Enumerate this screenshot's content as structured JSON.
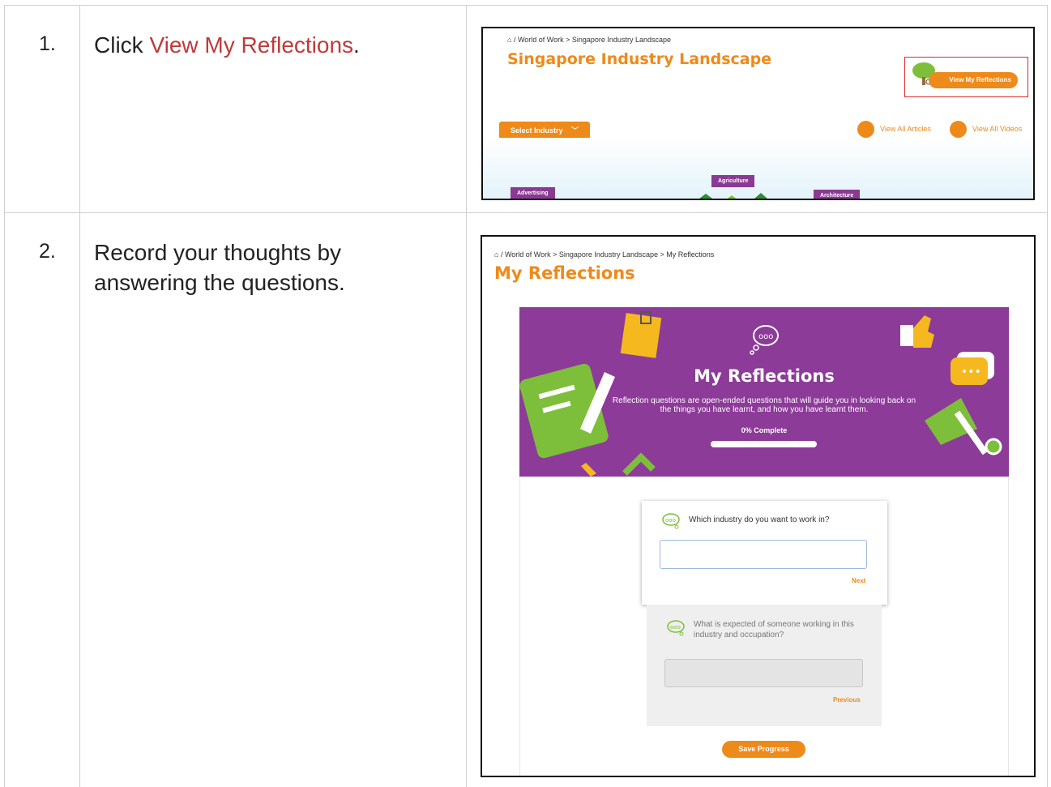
{
  "steps": [
    {
      "number": "1.",
      "text_before": "Click ",
      "link_text": "View My Reflections",
      "text_after": "."
    },
    {
      "number": "2.",
      "text": "Record your thoughts by answering the questions."
    }
  ],
  "screenshot1": {
    "breadcrumb": "/  World of Work > Singapore Industry Landscape",
    "title": "Singapore Industry Landscape",
    "reflections_button": "View My Reflections",
    "select_industry": "Select Industry",
    "view_articles": "View All Articles",
    "view_videos": "View All Videos",
    "tags": [
      "Advertising",
      "Agriculture",
      "Architecture"
    ]
  },
  "screenshot2": {
    "breadcrumb": "/  World of Work > Singapore Industry Landscape > My Reflections",
    "title": "My Reflections",
    "banner": {
      "title": "My Reflections",
      "description": "Reflection questions are open-ended questions that will guide you in looking back on the things you have learnt, and how you have learnt them.",
      "progress_label": "0% Complete",
      "progress_fraction": 0
    },
    "question1": "Which industry do you want to work in?",
    "question1_value": "",
    "next_label": "Next",
    "question2": "What is expected of someone working in this industry and occupation?",
    "question2_value": "",
    "previous_label": "Previous",
    "save_label": "Save Progress"
  },
  "colors": {
    "accent": "#ee8a1a",
    "purple": "#8c3b98",
    "highlight_red": "#c0393b",
    "green": "#7dbf3a"
  }
}
